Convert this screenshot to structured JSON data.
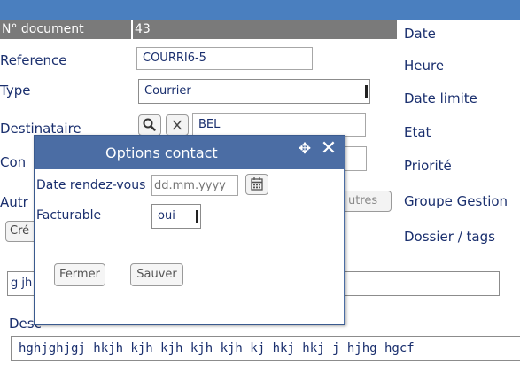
{
  "document_row": {
    "label": "N° document",
    "value": "43"
  },
  "left_labels": {
    "reference": "Reference",
    "type": "Type",
    "destinataire": "Destinataire",
    "con_partial": "Con",
    "autr_partial": "Autr",
    "cre_partial": "Cré",
    "g_partial": "g jh",
    "description_partial": "Desc"
  },
  "fields": {
    "reference_value": "COURRI6-5",
    "type_value": "Courrier",
    "destinataire_value": "BEL",
    "autres_button": "utres"
  },
  "right_labels": {
    "date": "Date",
    "heure": "Heure",
    "date_limite": "Date limite",
    "etat": "Etat",
    "priorite": "Priorité",
    "groupe_gestion": "Groupe Gestion",
    "dossier_tags": "Dossier / tags"
  },
  "description_text": "hghjghjgj hkjh kjh kjh kjh kjh kj hkj hkj j hjhg hgcf",
  "modal": {
    "title": "Options contact",
    "date_rdv_label": "Date rendez-vous",
    "date_rdv_placeholder": "dd.mm.yyyy",
    "facturable_label": "Facturable",
    "facturable_value": "oui",
    "fermer": "Fermer",
    "sauver": "Sauver"
  },
  "colors": {
    "top_bar": "#4a7fbf",
    "modal_header": "#4b6da4",
    "label_text": "#1a2f6e",
    "doc_row_bg": "#7a7a7a"
  },
  "icons": {
    "search": "search-icon",
    "clear": "clear-icon",
    "calendar": "calendar-icon",
    "move": "move-icon",
    "close": "close-icon"
  }
}
